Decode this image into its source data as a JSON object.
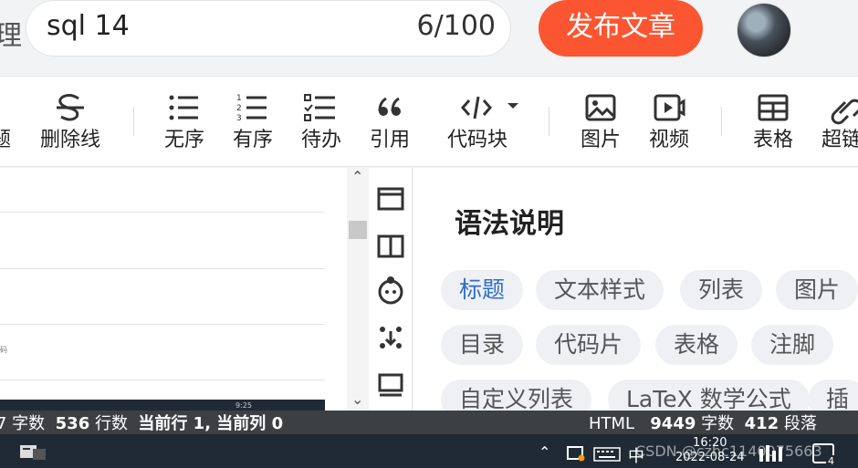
{
  "header": {
    "cut_title_char": "理",
    "title_value": "sql 14",
    "title_count": "6/100",
    "publish_label": "发布文章"
  },
  "toolbar": {
    "items": [
      {
        "label": "题",
        "icon": "heading-icon"
      },
      {
        "label": "删除线",
        "icon": "strikethrough-icon"
      },
      {
        "label": "无序",
        "icon": "unordered-list-icon"
      },
      {
        "label": "有序",
        "icon": "ordered-list-icon"
      },
      {
        "label": "待办",
        "icon": "todo-list-icon"
      },
      {
        "label": "引用",
        "icon": "quote-icon"
      },
      {
        "label": "代码块",
        "icon": "code-block-icon"
      },
      {
        "label": "图片",
        "icon": "image-icon"
      },
      {
        "label": "视频",
        "icon": "video-icon"
      },
      {
        "label": "表格",
        "icon": "table-icon"
      },
      {
        "label": "超链",
        "icon": "link-icon"
      }
    ]
  },
  "editor": {
    "tiny_text": "码",
    "thumb_time": "9:25"
  },
  "help": {
    "title": "语法说明",
    "chips": [
      "标题",
      "文本样式",
      "列表",
      "图片",
      "目录",
      "代码片",
      "表格",
      "注脚",
      "自定义列表",
      "LaTeX 数学公式",
      "插"
    ]
  },
  "status": {
    "left_prefix": "7 字数",
    "lines_count": "536",
    "lines_label": "行数",
    "current_line": "当前行 1, 当前列 0",
    "format": "HTML",
    "char_count": "9449",
    "char_label": "字数",
    "para_count": "412",
    "para_label": "段落"
  },
  "taskbar": {
    "ime": "中",
    "time": "16:20",
    "date": "2022-08-24",
    "watermark": "CSDN @czhc1140075663",
    "notif_count": "4"
  },
  "colors": {
    "accent": "#fc5531",
    "chip_bg": "#eef0f4",
    "active_chip": "#2f6fc9",
    "status_bg": "#3c4043",
    "taskbar_bg": "#202a35"
  }
}
